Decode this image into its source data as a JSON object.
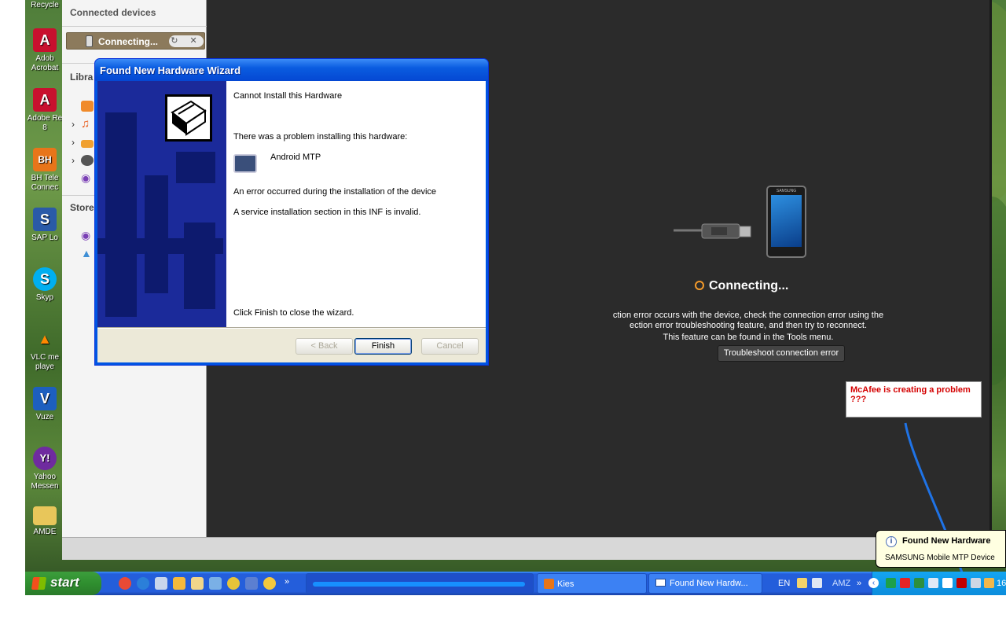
{
  "desktop": {
    "icons": [
      {
        "label": "Recycle",
        "glyph": "",
        "color": "#7c8fa8"
      },
      {
        "label": "Adob\nAcrobat",
        "glyph": "A",
        "color": "#c8102e"
      },
      {
        "label": "Adobe Re\n8",
        "glyph": "A",
        "color": "#c8102e"
      },
      {
        "label": "BH Tele\nConnec",
        "glyph": "BH",
        "color": "#e8751a"
      },
      {
        "label": "SAP Lo",
        "glyph": "S",
        "color": "#2a5aa8"
      },
      {
        "label": "Skyp",
        "glyph": "S",
        "color": "#00aff0"
      },
      {
        "label": "VLC me\nplaye",
        "glyph": "▲",
        "color": "#ff8800"
      },
      {
        "label": "Vuze",
        "glyph": "V",
        "color": "#1d5fbf"
      },
      {
        "label": "Yahoo\nMessen",
        "glyph": "Y!",
        "color": "#6f2b9f"
      },
      {
        "label": "AMDE",
        "glyph": "",
        "color": "#e8c65a"
      }
    ]
  },
  "kies": {
    "sidebar": {
      "connected_devices": "Connected devices",
      "device_status": "Connecting...",
      "device_actions": "↻ ✕",
      "library": "Libra",
      "store": "Store"
    },
    "main": {
      "status": "Connecting...",
      "message_lines": [
        "ction error occurs with the device, check the connection error using the",
        "ection error troubleshooting feature, and then try to reconnect.",
        "This feature can be found in the Tools menu."
      ],
      "troubleshoot_button": "Troubleshoot connection error",
      "phone_brand": "SAMSUNG"
    }
  },
  "wizard": {
    "title": "Found New Hardware Wizard",
    "heading": "Cannot Install this Hardware",
    "problem": "There was a problem installing this hardware:",
    "device": "Android MTP",
    "error1": "An error occurred during the installation of the device",
    "error2": "A service installation section in this INF is invalid.",
    "finish_hint": "Click Finish to close the wizard.",
    "back": "< Back",
    "finish": "Finish",
    "cancel": "Cancel"
  },
  "annotation": {
    "text": "McAfee is creating a problem ???",
    "color": "#d40000"
  },
  "balloon": {
    "title": "Found New Hardware",
    "subtitle": "SAMSUNG Mobile MTP Device"
  },
  "taskbar": {
    "start": "start",
    "buttons": {
      "kies": "Kies",
      "wizard": "Found New Hardw..."
    },
    "tray": {
      "lang": "EN",
      "amz": "AMZ",
      "clock": "16"
    }
  }
}
